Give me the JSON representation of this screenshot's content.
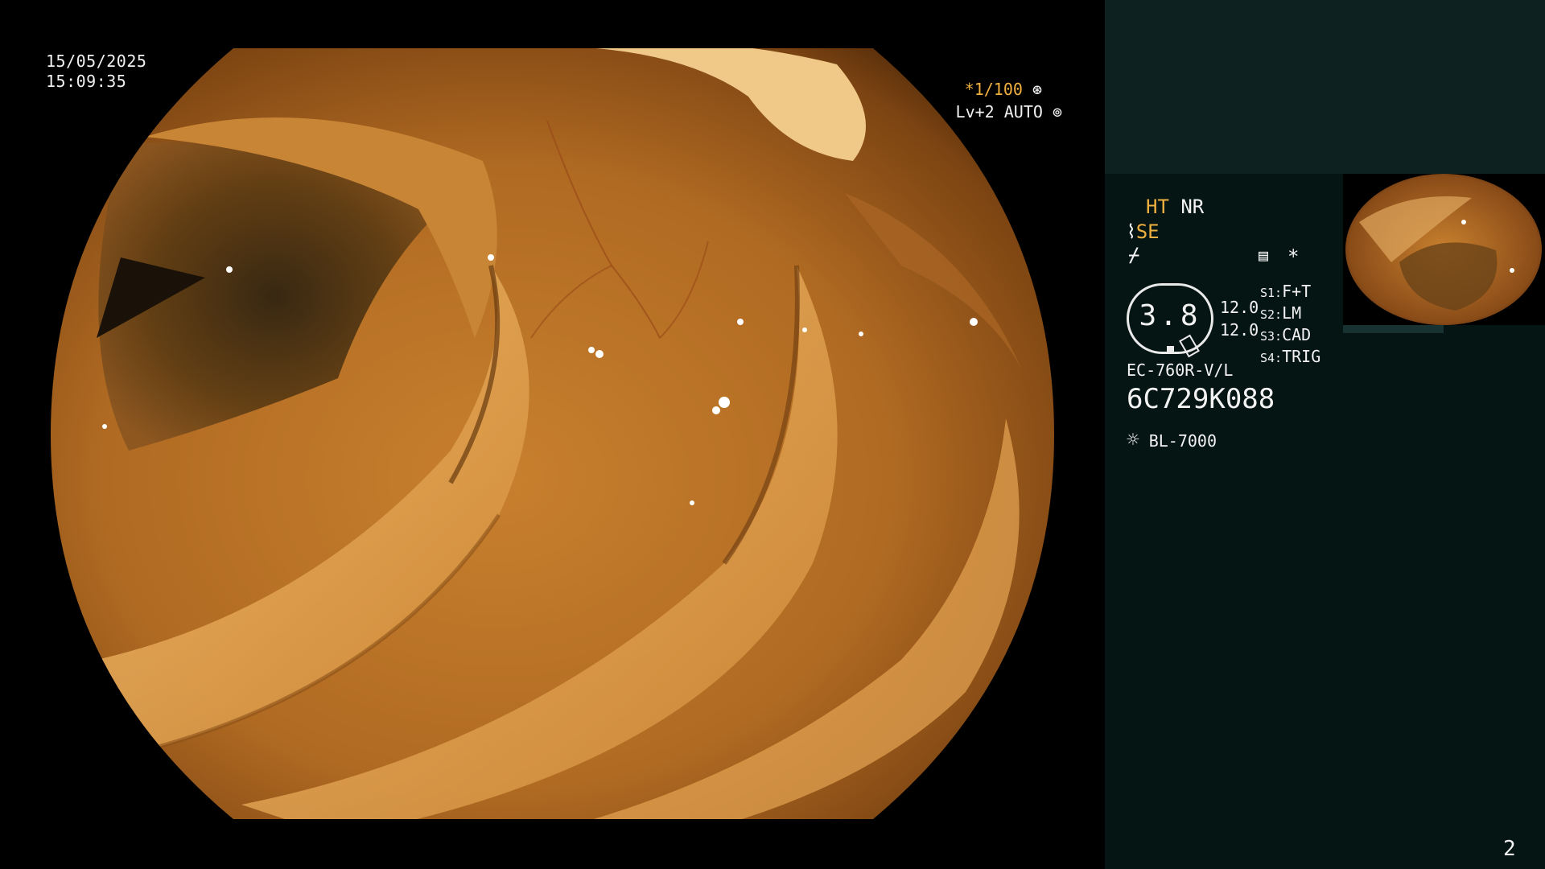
{
  "overlay": {
    "date": "15/05/2025",
    "time": "15:09:35",
    "shutter": "*1/100",
    "level": "Lv+2 AUTO"
  },
  "panel": {
    "ht": "HT",
    "nr": "NR",
    "se": "SE",
    "gauge_value": "3.8",
    "gauge_side_1": "12.0",
    "gauge_side_2": "12.0",
    "switches": [
      {
        "key": "S1:",
        "value": "F+T"
      },
      {
        "key": "S2:",
        "value": "LM"
      },
      {
        "key": "S3:",
        "value": "CAD"
      },
      {
        "key": "S4:",
        "value": "TRIG"
      }
    ],
    "scope_model": "EC-760R-V/L",
    "serial": "6C729K088",
    "light_source": "BL-7000",
    "page_number": "2"
  },
  "colors": {
    "panel_top": "#0c2120",
    "panel_bg": "#051514",
    "accent_orange": "#f0b040",
    "tissue": "#c07a2a"
  },
  "icons": [
    "aperture-icon",
    "iris-icon",
    "scope-tip-icon",
    "freeze-icon",
    "menu-icon",
    "asterisk-icon",
    "light-source-icon"
  ]
}
